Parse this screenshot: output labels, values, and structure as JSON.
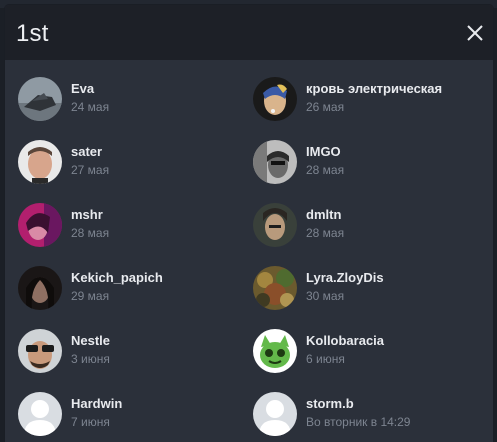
{
  "dialog": {
    "title": "1st"
  },
  "friends": [
    {
      "name": "Eva",
      "date": "24 мая"
    },
    {
      "name": "кровь электрическая",
      "date": "26 мая"
    },
    {
      "name": "sater",
      "date": "27 мая"
    },
    {
      "name": "IMGO",
      "date": "28 мая"
    },
    {
      "name": "mshr",
      "date": "28 мая"
    },
    {
      "name": "dmltn",
      "date": "28 мая"
    },
    {
      "name": "Kekich_papich",
      "date": "29 мая"
    },
    {
      "name": "Lyra.ZloyDis",
      "date": "30 мая"
    },
    {
      "name": "Nestle",
      "date": "3 июня"
    },
    {
      "name": "Kollobaracia",
      "date": "6 июня"
    },
    {
      "name": "Hardwin",
      "date": "7 июня"
    },
    {
      "name": "storm.b",
      "date": "Во вторник в 14:29"
    }
  ]
}
